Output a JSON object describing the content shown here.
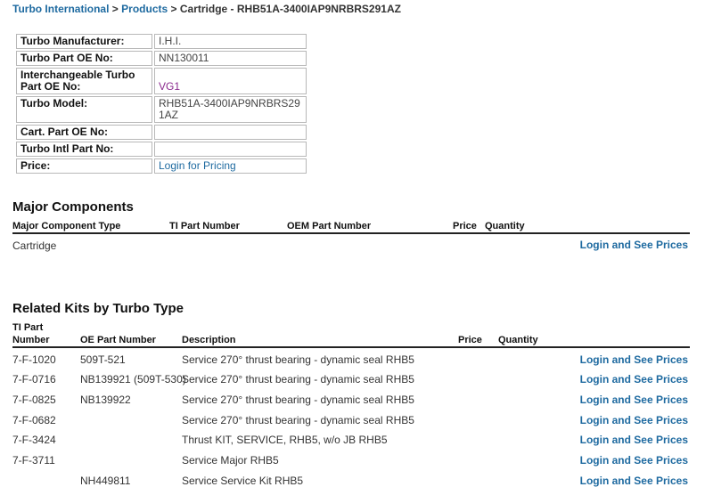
{
  "breadcrumb": {
    "home": "Turbo International",
    "sep1": ">",
    "products": "Products",
    "sep2": ">",
    "current": "Cartridge - RHB51A-3400IAP9NRBRS291AZ"
  },
  "spec_table": {
    "rows": [
      {
        "label": "Turbo Manufacturer:",
        "value": "I.H.I."
      },
      {
        "label": "Turbo Part OE No:",
        "value": "NN130011"
      },
      {
        "label": "Interchangeable Turbo Part OE No:",
        "value": "VG1"
      },
      {
        "label": "Turbo Model:",
        "value": "RHB51A-3400IAP9NRBRS291AZ"
      },
      {
        "label": "Cart. Part OE No:",
        "value": ""
      },
      {
        "label": "Turbo Intl Part No:",
        "value": ""
      },
      {
        "label": "Price:",
        "value": "Login for Pricing"
      }
    ]
  },
  "major_components": {
    "heading": "Major Components",
    "columns": {
      "type": "Major Component Type",
      "ti": "TI Part Number",
      "oem": "OEM Part Number",
      "price": "Price",
      "quantity": "Quantity"
    },
    "rows": [
      {
        "type": "Cartridge",
        "action": "Login and See Prices"
      }
    ]
  },
  "related_kits": {
    "heading": "Related Kits by Turbo Type",
    "columns": {
      "ti_line1": "TI Part",
      "ti_line2": "Number",
      "oe": "OE Part Number",
      "description": "Description",
      "price": "Price",
      "quantity": "Quantity"
    },
    "rows": [
      {
        "ti": "7-F-1020",
        "oe": "509T-521",
        "description": "Service 270° thrust bearing - dynamic seal RHB5",
        "action": "Login and See Prices"
      },
      {
        "ti": "7-F-0716",
        "oe": "NB139921 (509T-530)",
        "description": "Service 270° thrust bearing - dynamic seal RHB5",
        "action": "Login and See Prices"
      },
      {
        "ti": "7-F-0825",
        "oe": "NB139922",
        "description": "Service 270° thrust bearing - dynamic seal RHB5",
        "action": "Login and See Prices"
      },
      {
        "ti": "7-F-0682",
        "oe": "",
        "description": "Service 270° thrust bearing - dynamic seal RHB5",
        "action": "Login and See Prices"
      },
      {
        "ti": "7-F-3424",
        "oe": "",
        "description": "Thrust KIT, SERVICE, RHB5, w/o JB  RHB5",
        "action": "Login and See Prices"
      },
      {
        "ti": "7-F-3711",
        "oe": "",
        "description": "Service Major RHB5",
        "action": "Login and See Prices"
      },
      {
        "ti": "",
        "oe": "NH449811",
        "description": "Service Service Kit RHB5",
        "action": "Login and See Prices"
      }
    ]
  },
  "colors": {
    "link": "#1e6aa0",
    "visited_link": "#8a2a8e",
    "rule": "#222222",
    "table_border": "#b8b8b8"
  }
}
